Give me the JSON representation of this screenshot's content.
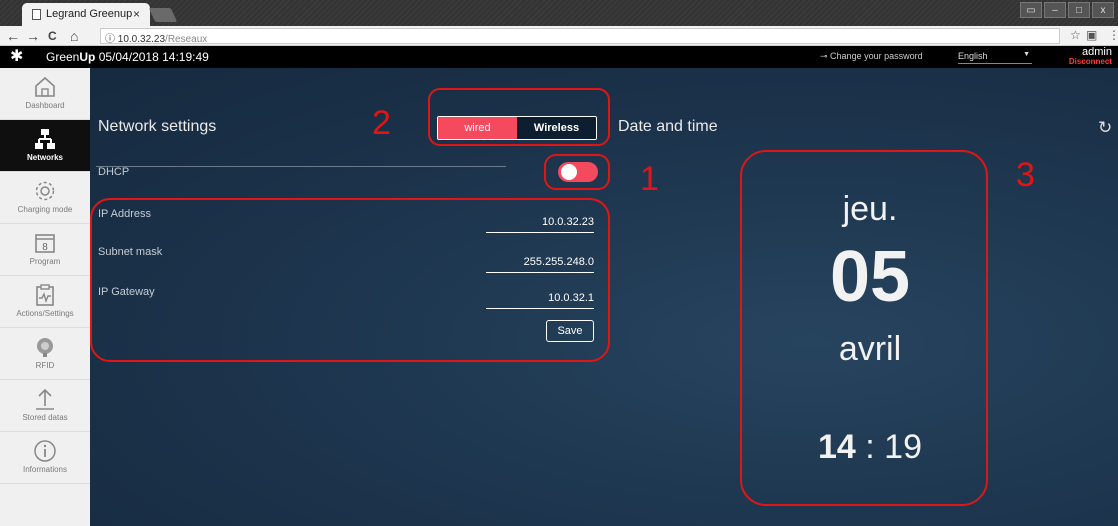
{
  "browser": {
    "tab_title": "Legrand Greenup",
    "tab_close": "×",
    "back": "←",
    "forward": "→",
    "reload": "C",
    "home": "⌂",
    "url_host": "10.0.32.23",
    "url_path": "/Reseaux",
    "win_buttons": [
      "▭",
      "–",
      "□",
      "x"
    ]
  },
  "header": {
    "brand_light": "Green",
    "brand_bold": "Up",
    "datetime": "05/04/2018 14:19:49",
    "change_password": "Change your password",
    "language": "English",
    "user": "admin",
    "disconnect": "Disconnect"
  },
  "sidebar": {
    "items": [
      {
        "label": "Dashboard",
        "icon": "home-icon"
      },
      {
        "label": "Networks",
        "icon": "network-icon"
      },
      {
        "label": "Charging mode",
        "icon": "gear-icon"
      },
      {
        "label": "Program",
        "icon": "calendar-icon"
      },
      {
        "label": "Actions/Settings",
        "icon": "clipboard-icon"
      },
      {
        "label": "RFID",
        "icon": "rfid-icon"
      },
      {
        "label": "Stored datas",
        "icon": "upload-icon"
      },
      {
        "label": "Informations",
        "icon": "info-icon"
      }
    ],
    "calendar_number": "8"
  },
  "network": {
    "title": "Network settings",
    "mode_wired": "wired",
    "mode_wireless": "Wireless",
    "dhcp_label": "DHCP",
    "dhcp_on": true,
    "ip_label": "IP Address",
    "ip_value": "10.0.32.23",
    "mask_label": "Subnet mask",
    "mask_value": "255.255.248.0",
    "gateway_label": "IP Gateway",
    "gateway_value": "10.0.32.1",
    "save": "Save"
  },
  "datetime": {
    "title": "Date and time",
    "weekday": "jeu.",
    "day": "05",
    "month": "avril",
    "hour": "14",
    "sep": " : ",
    "minute": "19"
  },
  "annotations": {
    "n1": "1",
    "n2": "2",
    "n3": "3"
  },
  "colors": {
    "accent": "#f5495e",
    "annotation": "#e01616",
    "panel_bg": "#1f3850"
  }
}
